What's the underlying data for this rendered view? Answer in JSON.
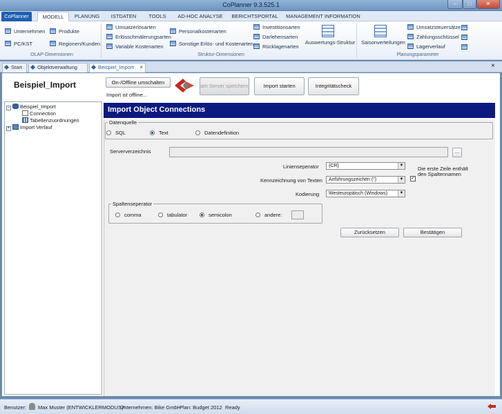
{
  "window": {
    "title": "CoPlanner 9.3.525.1",
    "min": "–",
    "max": "□",
    "close": "✕"
  },
  "menu": {
    "main": "CoPlanner",
    "tabs": [
      "MODELL",
      "PLANUNG",
      "ISTDATEN",
      "TOOLS",
      "AD-HOC ANALYSE",
      "BERICHTSPORTAL",
      "MANAGEMENT INFORMATION"
    ]
  },
  "ribbon": {
    "olap": {
      "items": [
        "Unternehmen",
        "Produkte",
        "PC/KST",
        "Regionen/Kunden"
      ],
      "label": "OLAP-Dimensionen"
    },
    "struktur": {
      "items": [
        "Umsatzerlösarten",
        "Personalkostenarten",
        "Investitionsarten",
        "Erlösschmälerungsarten",
        "Darlehensarten",
        "Variable Kostenarten",
        "Sonstige Erlös- und Kostenarten",
        "Rücklagenarten"
      ],
      "big": "Auswertungs-Struktur",
      "label": "Struktur-Dimensionen"
    },
    "planung": {
      "big": "Saisonverteilungen",
      "items": [
        "Umsatzsteuersätze",
        "Zahlungsschlüssel",
        "Lagerverlauf"
      ],
      "label": "Planungsparameter"
    }
  },
  "doctabs": {
    "items": [
      "Start",
      "Objektverwaltung",
      "Beispiel_Import"
    ],
    "close": "×",
    "close_all": "×"
  },
  "main": {
    "title": "Beispiel_Import",
    "onoff_button": "On-/Offline umschalten",
    "offline_text": "Import ist offline...",
    "save_server_button": "am Server speichern",
    "start_import_button": "Import starten",
    "integrity_button": "Integritätscheck"
  },
  "tree": {
    "root": "Beispiel_Import",
    "connection": "Connection",
    "tables": "Tabellenzuordnungen",
    "history": "Import Verlauf",
    "exp_minus": "–",
    "exp_plus": "+"
  },
  "header": "Import Object Connections",
  "datasource": {
    "legend": "Datenquelle",
    "options": [
      "SQL",
      "Text",
      "Datendefinition"
    ],
    "selected": "Text"
  },
  "form": {
    "server_label": "Serververzeichnis",
    "browse": "...",
    "line_sep_label": "Linienseperator",
    "line_sep_value": "{CR}",
    "text_mark_label": "Kennzeichnung von Texten",
    "text_mark_value": "Anführungszeichen (\")",
    "encoding_label": "Kodierung",
    "encoding_value": "Westeuropäisch (Windows)",
    "first_row_checkbox": "✓",
    "first_row_label": "Die erste Zeile enthält den Spaltennamen"
  },
  "colsep": {
    "legend": "Spaltenseperator",
    "options": [
      "comma",
      "tabulator",
      "semicolon",
      "andere:"
    ],
    "selected": "semicolon"
  },
  "actions": {
    "reset": "Zurücksetzen",
    "confirm": "Bestätigen"
  },
  "statusbar": {
    "user_label": "Benutzer:",
    "user": "Max Muster (ENTWICKLERMODUS)*",
    "company": "Unternehmen: Bike GmbH",
    "plan": "Plan: Budget 2012",
    "ready": "Ready"
  }
}
